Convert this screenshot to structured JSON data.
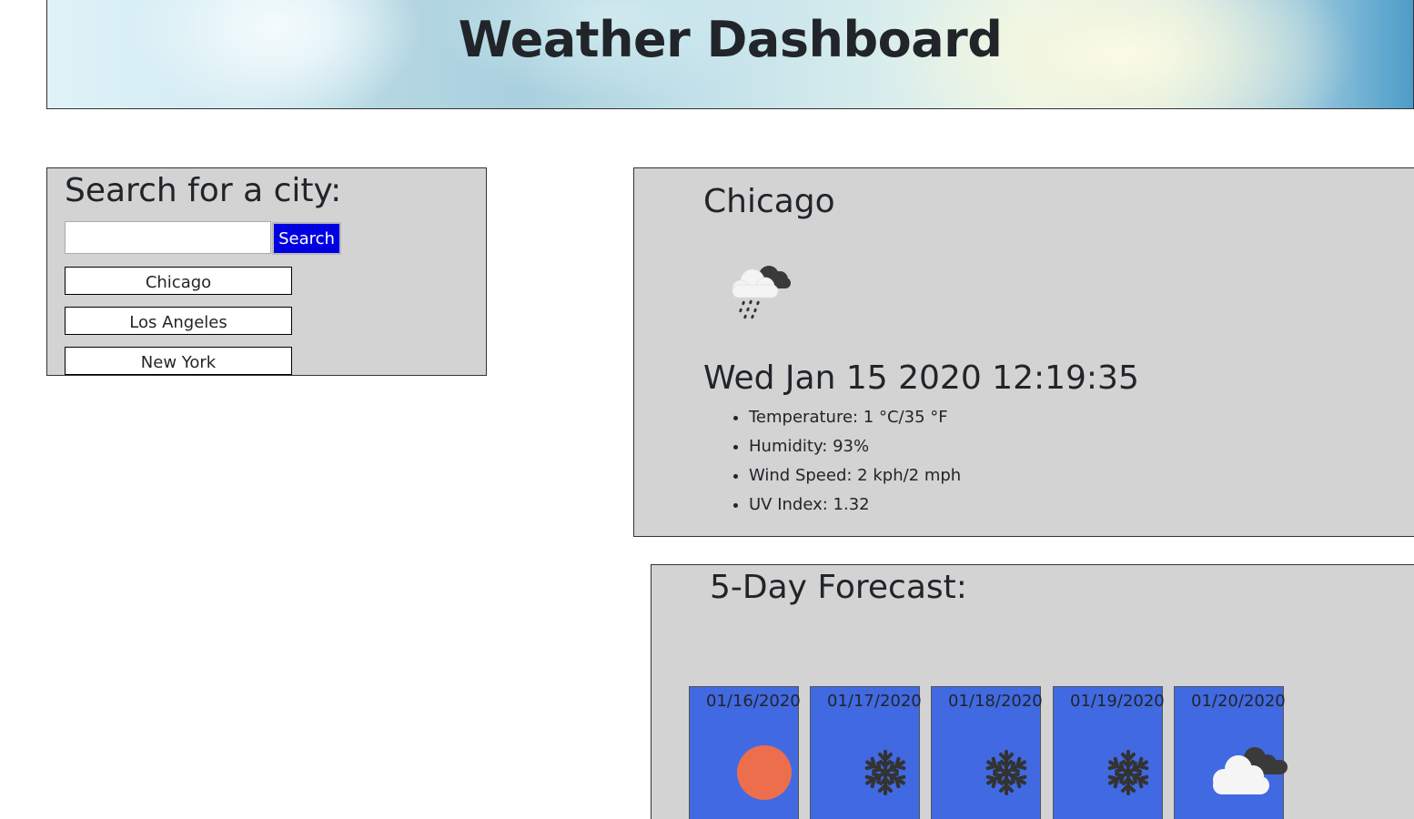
{
  "header": {
    "title": "Weather Dashboard"
  },
  "search": {
    "heading": "Search for a city:",
    "input_value": "",
    "input_placeholder": "",
    "button_label": "Search",
    "history": [
      "Chicago",
      "Los Angeles",
      "New York"
    ]
  },
  "current": {
    "city": "Chicago",
    "icon": "rain-cloud-icon",
    "datetime": "Wed Jan 15 2020 12:19:35",
    "temperature": "Temperature: 1 °C/35 °F",
    "humidity": "Humidity: 93%",
    "wind": "Wind Speed: 2 kph/2 mph",
    "uv": "UV Index: 1.32"
  },
  "forecast": {
    "heading": "5-Day Forecast:",
    "days": [
      {
        "date": "01/16/2020",
        "icon": "sun-icon"
      },
      {
        "date": "01/17/2020",
        "icon": "snowflake-icon"
      },
      {
        "date": "01/18/2020",
        "icon": "snowflake-icon"
      },
      {
        "date": "01/19/2020",
        "icon": "snowflake-icon"
      },
      {
        "date": "01/20/2020",
        "icon": "cloud-icon"
      }
    ]
  },
  "colors": {
    "panel_bg": "#d3d3d3",
    "search_button": "#0000e0",
    "forecast_card": "#4169e1",
    "sun": "#ec6e4c",
    "snow": "#333333"
  }
}
